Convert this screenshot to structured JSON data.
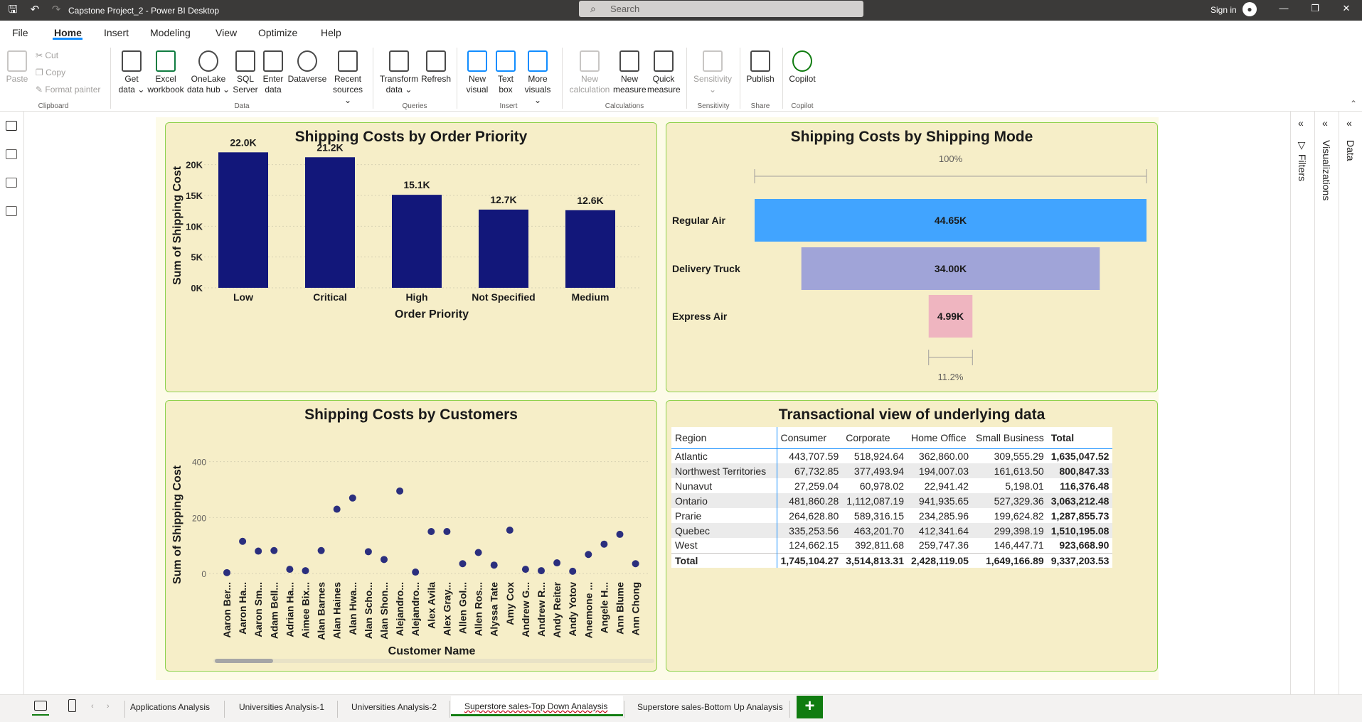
{
  "window": {
    "title": "Capstone Project_2 - Power BI Desktop",
    "search_placeholder": "Search",
    "signin": "Sign in"
  },
  "menu": {
    "items": [
      "File",
      "Home",
      "Insert",
      "Modeling",
      "View",
      "Optimize",
      "Help"
    ]
  },
  "ribbon": {
    "paste": "Paste",
    "cut": "Cut",
    "copy": "Copy",
    "format_painter": "Format painter",
    "get_data": [
      "Get",
      "data ⌄"
    ],
    "excel": [
      "Excel",
      "workbook"
    ],
    "onelake": [
      "OneLake",
      "data hub ⌄"
    ],
    "sql": [
      "SQL",
      "Server"
    ],
    "enter_data": [
      "Enter",
      "data"
    ],
    "dataverse": "Dataverse",
    "recent": [
      "Recent",
      "sources ⌄"
    ],
    "transform": [
      "Transform",
      "data ⌄"
    ],
    "refresh": "Refresh",
    "new_visual": [
      "New",
      "visual"
    ],
    "text_box": [
      "Text",
      "box"
    ],
    "more_visuals": [
      "More",
      "visuals ⌄"
    ],
    "new_calc": [
      "New",
      "calculation"
    ],
    "new_measure": [
      "New",
      "measure"
    ],
    "quick_measure": [
      "Quick",
      "measure"
    ],
    "sensitivity": [
      "Sensitivity",
      "⌄"
    ],
    "publish": "Publish",
    "copilot": "Copilot",
    "groups": {
      "clipboard": "Clipboard",
      "data": "Data",
      "queries": "Queries",
      "insert": "Insert",
      "calculations": "Calculations",
      "sensitivity": "Sensitivity",
      "share": "Share",
      "copilot": "Copilot"
    }
  },
  "panes": {
    "filters": "Filters",
    "visualizations": "Visualizations",
    "data": "Data"
  },
  "tabs": [
    "Applications Analysis",
    "Universities Analysis-1",
    "Universities Analysis-2",
    "Superstore sales-Top Down Analaysis",
    "Superstore sales-Bottom Up Analaysis"
  ],
  "add_page": "+",
  "visuals": {
    "bar_title": "Shipping Costs by Order Priority",
    "funnel_title": "Shipping Costs by Shipping Mode",
    "scatter_title": "Shipping Costs by Customers",
    "table_title": "Transactional view of underlying data"
  },
  "chart_data": [
    {
      "type": "bar",
      "title": "Shipping Costs by Order Priority",
      "xlabel": "Order Priority",
      "ylabel": "Sum of Shipping Cost",
      "categories": [
        "Low",
        "Critical",
        "High",
        "Not Specified",
        "Medium"
      ],
      "values": [
        22000,
        21200,
        15100,
        12700,
        12600
      ],
      "data_labels": [
        "22.0K",
        "21.2K",
        "15.1K",
        "12.7K",
        "12.6K"
      ],
      "yticks": [
        "0K",
        "5K",
        "10K",
        "15K",
        "20K"
      ],
      "ylim": [
        0,
        22500
      ],
      "color": "#12177a"
    },
    {
      "type": "funnel",
      "title": "Shipping Costs by Shipping Mode",
      "categories": [
        "Regular Air",
        "Delivery Truck",
        "Express Air"
      ],
      "values": [
        44650,
        34000,
        4990
      ],
      "data_labels": [
        "44.65K",
        "34.00K",
        "4.99K"
      ],
      "colors": [
        "#41a4ff",
        "#a0a4d8",
        "#efb5c0"
      ],
      "top_pct": "100%",
      "bottom_pct": "11.2%"
    },
    {
      "type": "scatter",
      "title": "Shipping Costs by Customers",
      "xlabel": "Customer Name",
      "ylabel": "Sum of Shipping Cost",
      "categories": [
        "Aaron Ber...",
        "Aaron Ha...",
        "Aaron Sm...",
        "Adam Bell...",
        "Adrian Ha...",
        "Aimee Bix...",
        "Alan Barnes",
        "Alan Haines",
        "Alan Hwa...",
        "Alan Scho...",
        "Alan Shon...",
        "Alejandro...",
        "Alejandro...",
        "Alex Avila",
        "Alex Gray...",
        "Allen Gol...",
        "Allen Ros...",
        "Alyssa Tate",
        "Amy Cox",
        "Andrew G...",
        "Andrew R...",
        "Andy Reiter",
        "Andy Yotov",
        "Anemone ...",
        "Angele H...",
        "Ann Blume",
        "Ann Chong"
      ],
      "values": [
        3,
        115,
        80,
        82,
        15,
        10,
        82,
        230,
        270,
        78,
        50,
        295,
        5,
        150,
        150,
        35,
        75,
        30,
        155,
        15,
        10,
        38,
        8,
        68,
        105,
        140,
        35
      ],
      "yticks": [
        "0",
        "200",
        "400"
      ],
      "ylim": [
        0,
        450
      ],
      "color": "#2b2f7e"
    },
    {
      "type": "table",
      "title": "Transactional view of underlying data",
      "columns": [
        "Region",
        "Consumer",
        "Corporate",
        "Home Office",
        "Small Business",
        "Total"
      ],
      "rows": [
        [
          "Atlantic",
          "443,707.59",
          "518,924.64",
          "362,860.00",
          "309,555.29",
          "1,635,047.52"
        ],
        [
          "Northwest Territories",
          "67,732.85",
          "377,493.94",
          "194,007.03",
          "161,613.50",
          "800,847.33"
        ],
        [
          "Nunavut",
          "27,259.04",
          "60,978.02",
          "22,941.42",
          "5,198.01",
          "116,376.48"
        ],
        [
          "Ontario",
          "481,860.28",
          "1,112,087.19",
          "941,935.65",
          "527,329.36",
          "3,063,212.48"
        ],
        [
          "Prarie",
          "264,628.80",
          "589,316.15",
          "234,285.96",
          "199,624.82",
          "1,287,855.73"
        ],
        [
          "Quebec",
          "335,253.56",
          "463,201.70",
          "412,341.64",
          "299,398.19",
          "1,510,195.08"
        ],
        [
          "West",
          "124,662.15",
          "392,811.68",
          "259,747.36",
          "146,447.71",
          "923,668.90"
        ]
      ],
      "total": [
        "Total",
        "1,745,104.27",
        "3,514,813.31",
        "2,428,119.05",
        "1,649,166.89",
        "9,337,203.53"
      ]
    }
  ]
}
